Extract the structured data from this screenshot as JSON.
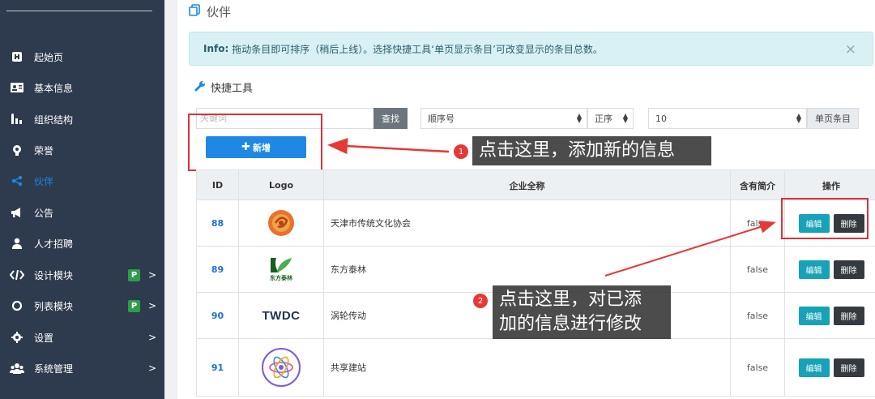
{
  "sidebar": {
    "items": [
      {
        "label": "起始页",
        "icon": "home-icon"
      },
      {
        "label": "基本信息",
        "icon": "id-card-icon"
      },
      {
        "label": "组织结构",
        "icon": "org-chart-icon"
      },
      {
        "label": "荣誉",
        "icon": "medal-icon"
      },
      {
        "label": "伙伴",
        "icon": "share-icon",
        "active": true
      },
      {
        "label": "公告",
        "icon": "megaphone-icon"
      },
      {
        "label": "人才招聘",
        "icon": "user-icon"
      },
      {
        "label": "设计模块",
        "icon": "code-icon",
        "badge": "P",
        "chevron": ">"
      },
      {
        "label": "列表模块",
        "icon": "circle-icon",
        "badge": "P",
        "chevron": ">"
      },
      {
        "label": "设置",
        "icon": "gear-icon",
        "chevron": ">"
      },
      {
        "label": "系统管理",
        "icon": "users-icon",
        "chevron": ">"
      }
    ]
  },
  "page": {
    "title": "伙伴"
  },
  "info": {
    "prefix": "Info:",
    "text": "拖动条目即可排序（稍后上线）。选择快捷工具‘单页显示条目’可改变显示的条目总数。",
    "close": "×"
  },
  "tools": {
    "title": "快捷工具",
    "search_placeholder": "关键词",
    "search_button": "查找",
    "sort_field": "顺序号",
    "sort_order": "正序",
    "page_size": "10",
    "page_size_label": "单页条目",
    "add_button": "新增"
  },
  "table": {
    "headers": [
      "ID",
      "Logo",
      "企业全称",
      "含有简介",
      "操作"
    ],
    "rows": [
      {
        "id": "88",
        "logo": "orange-swirl-logo",
        "name": "天津市传统文化协会",
        "intro": "false"
      },
      {
        "id": "89",
        "logo": "green-leaf-logo",
        "logo_text": "东方泰林",
        "name": "东方泰林",
        "intro": "false"
      },
      {
        "id": "90",
        "logo": "twdc-logo",
        "logo_text": "TWDC",
        "name": "涡轮传动",
        "intro": "false"
      },
      {
        "id": "91",
        "logo": "atom-circle-logo",
        "name": "共享建站",
        "intro": "false"
      }
    ],
    "edit_label": "编辑",
    "delete_label": "删除"
  },
  "annotations": [
    {
      "num": "1",
      "text": "点击这里，添加新的信息"
    },
    {
      "num": "2",
      "text_line1": "点击这里，对已添",
      "text_line2": "加的信息进行修改"
    }
  ],
  "colors": {
    "sidebar_bg": "#2e3a4d",
    "primary": "#1e88e5",
    "info_bg": "#d9f1f5",
    "edit": "#17a2b8",
    "delete": "#343a40",
    "annotation_red": "#e53935"
  }
}
